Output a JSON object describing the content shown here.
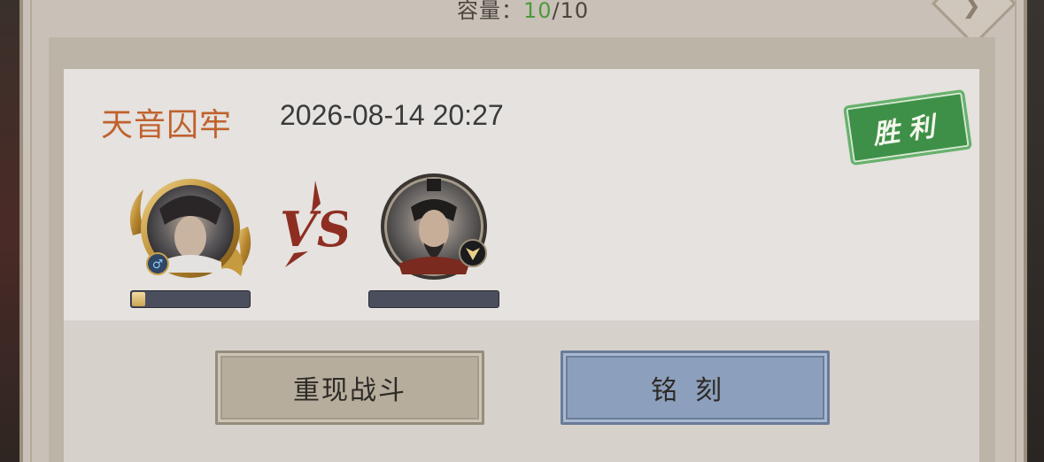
{
  "capacity": {
    "label": "容量：",
    "current": "10",
    "separator": "/",
    "max": "10"
  },
  "battle": {
    "location": "天音囚牢",
    "datetime": "2026-08-14 20:27",
    "result": "胜利",
    "vs_label": "VS",
    "player": {
      "gender_icon": "♂",
      "hp_fraction": 0.13
    },
    "enemy": {
      "hp_fraction": 0.0
    }
  },
  "buttons": {
    "replay": "重现战斗",
    "engrave": "铭刻"
  },
  "colors": {
    "location": "#c0622e",
    "capacity_current": "#4d9a3c",
    "stamp": "#3e9048",
    "replay_button": "#b6ad9d",
    "engrave_button": "#8c9fbc"
  }
}
